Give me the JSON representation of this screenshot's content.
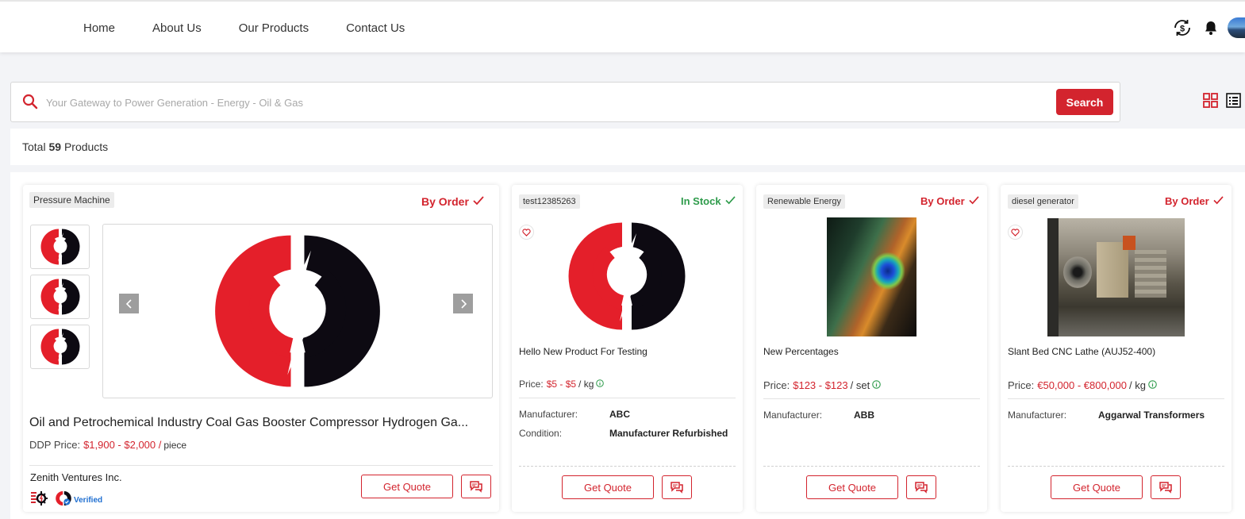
{
  "nav": {
    "home": "Home",
    "about": "About Us",
    "products": "Our Products",
    "contact": "Contact Us"
  },
  "search": {
    "placeholder": "Your Gateway to Power Generation - Energy - Oil & Gas",
    "button": "Search"
  },
  "total": {
    "prefix": "Total",
    "count": "59",
    "suffix": "Products"
  },
  "colors": {
    "accent": "#d3242e",
    "in_stock": "#2e9b4b"
  },
  "featured": {
    "tag": "Pressure Machine",
    "status": "By Order",
    "title": "Oil and Petrochemical Industry Coal Gas Booster Compressor Hydrogen Ga...",
    "price_label": "DDP Price:",
    "price": "$1,900 - $2,000 /",
    "unit": "piece",
    "seller": "Zenith Ventures Inc.",
    "verified": "Verified",
    "quote": "Get Quote"
  },
  "products": [
    {
      "tag": "test12385263",
      "status": "In Stock",
      "title": "Hello New Product For Testing",
      "price_label": "Price:",
      "price": "$5 - $5",
      "unit": "/ kg",
      "manufacturer_label": "Manufacturer:",
      "manufacturer": "ABC",
      "condition_label": "Condition:",
      "condition": "Manufacturer Refurbished",
      "quote": "Get Quote"
    },
    {
      "tag": "Renewable Energy",
      "status": "By Order",
      "title": "New Percentages",
      "price_label": "Price:",
      "price": "$123 - $123",
      "unit": "/ set",
      "manufacturer_label": "Manufacturer:",
      "manufacturer": "ABB",
      "quote": "Get Quote"
    },
    {
      "tag": "diesel generator",
      "status": "By Order",
      "title": "Slant Bed CNC Lathe (AUJ52-400)",
      "price_label": "Price:",
      "price": "€50,000 - €800,000",
      "unit": "/ kg",
      "manufacturer_label": "Manufacturer:",
      "manufacturer": "Aggarwal Transformers",
      "quote": "Get Quote"
    }
  ]
}
